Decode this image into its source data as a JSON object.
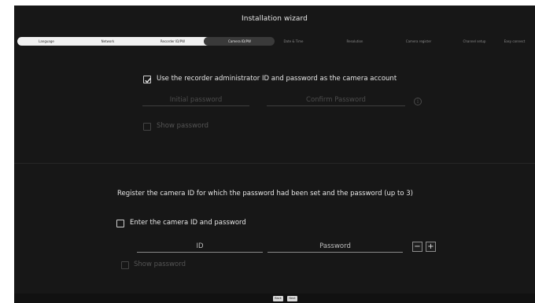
{
  "window": {
    "title": "Installation wizard"
  },
  "steps": [
    {
      "label": "Language",
      "state": "done"
    },
    {
      "label": "Network",
      "state": "done"
    },
    {
      "label": "Recorder ID/PW",
      "state": "done"
    },
    {
      "label": "Camera ID/PW",
      "state": "current"
    },
    {
      "label": "Date & Time",
      "state": "todo"
    },
    {
      "label": "Resolution",
      "state": "todo"
    },
    {
      "label": "Camera register",
      "state": "todo"
    },
    {
      "label": "Channel setup",
      "state": "todo"
    },
    {
      "label": "Easy connect",
      "state": "todo"
    }
  ],
  "section1": {
    "use_admin_checked": true,
    "use_admin_label": "Use the recorder administrator ID and password as the camera account",
    "initial_password_placeholder": "Initial password",
    "confirm_password_placeholder": "Confirm Password",
    "info_icon": "info-icon",
    "show_password_label": "Show password"
  },
  "section2": {
    "heading": "Register the camera ID for which the password had been set and the password (up to 3)",
    "enter_id_checked": false,
    "enter_id_label": "Enter the camera ID and password",
    "id_placeholder": "ID",
    "password_placeholder": "Password",
    "minus_label": "−",
    "plus_label": "+",
    "show_password_label": "Show password"
  },
  "footer": {
    "back_label": "Back",
    "next_label": "Next"
  },
  "colors": {
    "background": "#171717",
    "step_done_bg": "#f1f1f1",
    "step_current_bg": "#3a3a3a"
  }
}
